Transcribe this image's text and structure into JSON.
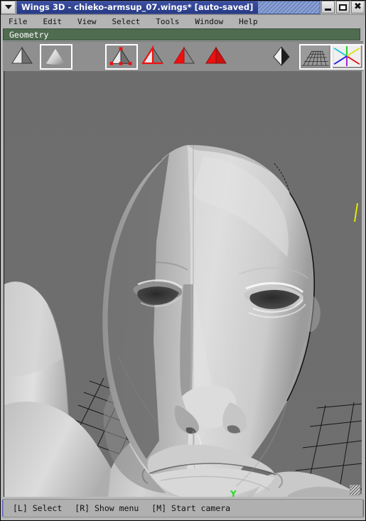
{
  "window": {
    "title": "Wings 3D - chieko-armsup_07.wings* [auto-saved]",
    "system_menu_icon": "chevron-down-icon",
    "minimize_label": "–",
    "maximize_label": "❑",
    "close_label": "✖"
  },
  "menubar": {
    "items": [
      {
        "label": "File"
      },
      {
        "label": "Edit"
      },
      {
        "label": "View"
      },
      {
        "label": "Select"
      },
      {
        "label": "Tools"
      },
      {
        "label": "Window"
      },
      {
        "label": "Help"
      }
    ]
  },
  "geometry_panel": {
    "caption": "Geometry"
  },
  "toolbar": {
    "buttons": [
      {
        "name": "smooth-preview-off",
        "tooltip": "Flat shading",
        "selected": false,
        "icon": "flat-pyramid-icon"
      },
      {
        "name": "smooth-preview-on",
        "tooltip": "Smooth shading",
        "selected": true,
        "icon": "smooth-pyramid-icon"
      },
      {
        "name": "vertex-mode",
        "tooltip": "Vertex selection mode",
        "selected": true,
        "icon": "pyramid-vertices-icon"
      },
      {
        "name": "edge-mode",
        "tooltip": "Edge selection mode",
        "selected": false,
        "icon": "pyramid-edges-icon"
      },
      {
        "name": "face-mode",
        "tooltip": "Face selection mode",
        "selected": false,
        "icon": "pyramid-face-icon"
      },
      {
        "name": "body-mode",
        "tooltip": "Body selection mode",
        "selected": false,
        "icon": "pyramid-body-icon"
      },
      {
        "name": "workmode-toggle",
        "tooltip": "Toggle workmode",
        "selected": false,
        "icon": "pyramid-shaded-icon"
      },
      {
        "name": "show-grid-toggle",
        "tooltip": "Show ground plane",
        "selected": true,
        "icon": "ground-grid-icon"
      },
      {
        "name": "show-axes-toggle",
        "tooltip": "Show axes",
        "selected": true,
        "icon": "axes-icon"
      }
    ],
    "accent_red": "#ee1111",
    "accent_white": "#ffffff"
  },
  "viewport": {
    "background_color": "#6e6e6e",
    "model_name": "human head",
    "axis_labels": [
      {
        "text": "Y",
        "color": "#22dd22"
      }
    ],
    "grid_color": "#111111",
    "highlight_color": "#e8e800"
  },
  "statusbar": {
    "segments": [
      {
        "key": "[L]",
        "action": "Select"
      },
      {
        "key": "[R]",
        "action": "Show menu"
      },
      {
        "key": "[M]",
        "action": "Start camera"
      }
    ],
    "accent_color": "#5b62c9"
  }
}
